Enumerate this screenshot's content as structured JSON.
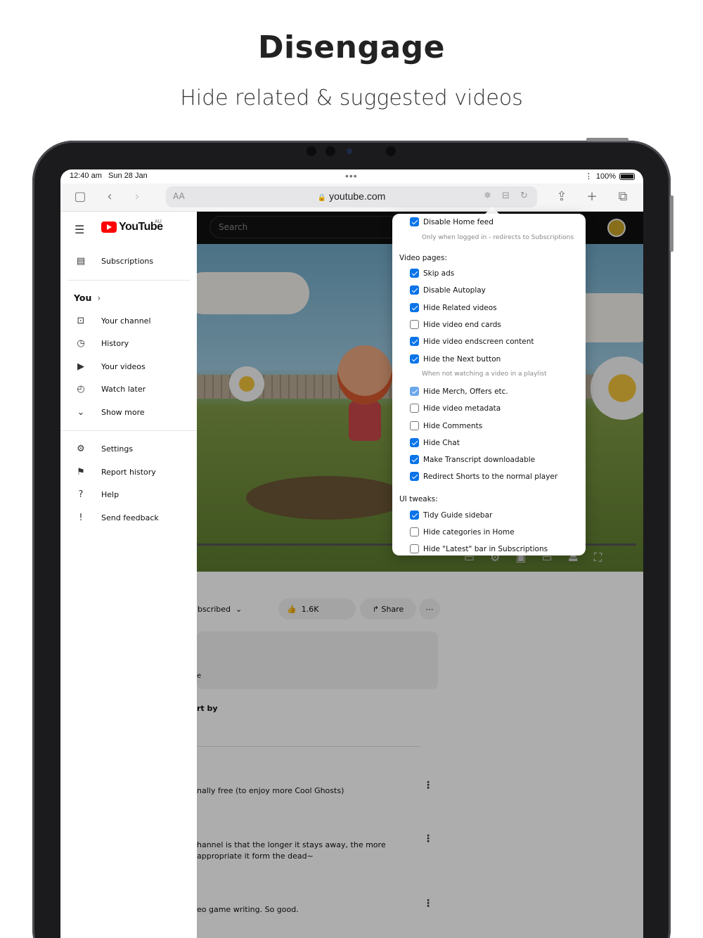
{
  "headline": "Disengage",
  "subhead": "Hide related & suggested videos",
  "status": {
    "time": "12:40 am",
    "date": "Sun 28 Jan",
    "battery": "100%"
  },
  "browser": {
    "url": "youtube.com",
    "aa": "AA"
  },
  "sidebar": {
    "logo_text": "YouTube",
    "region": "AU",
    "subscriptions": "Subscriptions",
    "you": "You",
    "you_items": [
      "Your channel",
      "History",
      "Your videos",
      "Watch later",
      "Show more"
    ],
    "bottom_items": [
      "Settings",
      "Report history",
      "Help",
      "Send feedback"
    ]
  },
  "main": {
    "search_placeholder": "Search",
    "subscribed": "ubscribed",
    "likes": "1.6K",
    "share": "Share",
    "desc_fragment": "e",
    "sort": "rt by",
    "comments": [
      "nally free (to enjoy more Cool Ghosts)",
      "hannel is that the longer it stays away, the more appropriate it form the dead~",
      "eo game writing. So good."
    ]
  },
  "popover": {
    "disable_home": {
      "label": "Disable Home feed",
      "checked": true
    },
    "disable_home_hint": "Only when logged in - redirects to Subscriptions",
    "video_section": "Video pages:",
    "video_items": [
      {
        "label": "Skip ads",
        "checked": true
      },
      {
        "label": "Disable Autoplay",
        "checked": true
      },
      {
        "label": "Hide Related videos",
        "checked": true
      },
      {
        "label": "Hide video end cards",
        "checked": false
      },
      {
        "label": "Hide video endscreen content",
        "checked": true
      },
      {
        "label": "Hide the Next button",
        "checked": true
      }
    ],
    "next_hint": "When not watching a video in a playlist",
    "video_items2": [
      {
        "label": "Hide Merch, Offers etc.",
        "checked": true
      },
      {
        "label": "Hide video metadata",
        "checked": false
      },
      {
        "label": "Hide Comments",
        "checked": false
      },
      {
        "label": "Hide Chat",
        "checked": true
      },
      {
        "label": "Make Transcript downloadable",
        "checked": true
      },
      {
        "label": "Redirect Shorts to the normal player",
        "checked": true
      }
    ],
    "ui_section": "UI tweaks:",
    "ui_items": [
      {
        "label": "Tidy Guide sidebar",
        "checked": true
      },
      {
        "label": "Hide categories in Home",
        "checked": false
      },
      {
        "label": "Hide \"Latest\" bar in Subscriptions",
        "checked": false
      }
    ]
  }
}
